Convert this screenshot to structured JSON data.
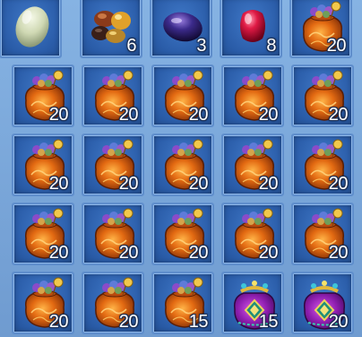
{
  "inventory": {
    "slots": [
      {
        "item": "pale-moonstone-icon",
        "quantity": ""
      },
      {
        "item": "mixed-gemstones-icon",
        "quantity": "6"
      },
      {
        "item": "dark-purple-gem-icon",
        "quantity": "3"
      },
      {
        "item": "red-ruby-icon",
        "quantity": "8"
      },
      {
        "item": "orange-loot-bag-icon",
        "quantity": "20"
      },
      {
        "item": "orange-loot-bag-icon",
        "quantity": "20"
      },
      {
        "item": "orange-loot-bag-icon",
        "quantity": "20"
      },
      {
        "item": "orange-loot-bag-icon",
        "quantity": "20"
      },
      {
        "item": "orange-loot-bag-icon",
        "quantity": "20"
      },
      {
        "item": "orange-loot-bag-icon",
        "quantity": "20"
      },
      {
        "item": "orange-loot-bag-icon",
        "quantity": "20"
      },
      {
        "item": "orange-loot-bag-icon",
        "quantity": "20"
      },
      {
        "item": "orange-loot-bag-icon",
        "quantity": "20"
      },
      {
        "item": "orange-loot-bag-icon",
        "quantity": "20"
      },
      {
        "item": "orange-loot-bag-icon",
        "quantity": "20"
      },
      {
        "item": "orange-loot-bag-icon",
        "quantity": "20"
      },
      {
        "item": "orange-loot-bag-icon",
        "quantity": "20"
      },
      {
        "item": "orange-loot-bag-icon",
        "quantity": "20"
      },
      {
        "item": "orange-loot-bag-icon",
        "quantity": "20"
      },
      {
        "item": "orange-loot-bag-icon",
        "quantity": "20"
      },
      {
        "item": "orange-loot-bag-icon",
        "quantity": "20"
      },
      {
        "item": "orange-loot-bag-icon",
        "quantity": "20"
      },
      {
        "item": "orange-loot-bag-icon",
        "quantity": "15"
      },
      {
        "item": "purple-pouch-icon",
        "quantity": "15"
      },
      {
        "item": "purple-pouch-icon",
        "quantity": "20"
      }
    ]
  },
  "colors": {
    "slot_background": "#2a5ca8",
    "slot_border": "#5f8ecc",
    "grid_background": "#7aa7d8",
    "quantity_text": "#ffffff"
  }
}
